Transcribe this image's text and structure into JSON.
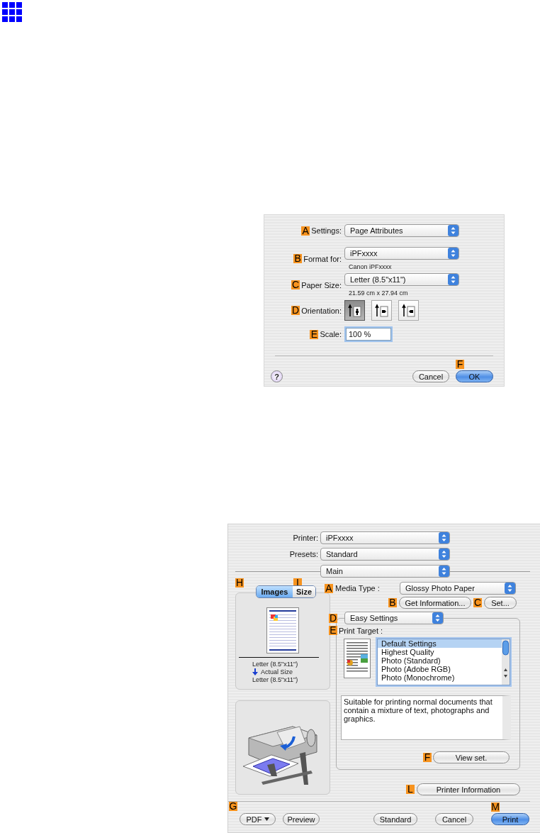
{
  "page_setup": {
    "rows": [
      {
        "kind": "popup",
        "marker": "A",
        "label": "Settings:",
        "value": "Page Attributes"
      },
      {
        "kind": "popup",
        "marker": "B",
        "label": "Format for:",
        "value": "iPFxxxx",
        "note": "Canon iPFxxxx"
      },
      {
        "kind": "popup",
        "marker": "C",
        "label": "Paper Size:",
        "value": "Letter (8.5\"x11\")",
        "note": "21.59 cm x 27.94 cm"
      },
      {
        "kind": "orientation",
        "marker": "D",
        "label": "Orientation:",
        "options": [
          {
            "selected": true
          },
          {
            "selected": false
          },
          {
            "selected": false
          }
        ]
      },
      {
        "kind": "field",
        "marker": "E",
        "label": "Scale:",
        "value": "100 %"
      }
    ],
    "help": "?",
    "buttons": [
      {
        "label": "Cancel",
        "default": false
      },
      {
        "marker": "F",
        "label": "OK",
        "default": true
      }
    ]
  },
  "print_dialog": {
    "top_rows": [
      {
        "label": "Printer:",
        "value": "iPFxxxx"
      },
      {
        "label": "Presets:",
        "value": "Standard"
      }
    ],
    "panel": "Main",
    "tabs": [
      {
        "marker": "H",
        "label": "Images",
        "selected": true
      },
      {
        "marker": "I",
        "label": "Size",
        "selected": false
      }
    ],
    "preview_text": {
      "source": "Letter (8.5\"x11\")",
      "scale": "Actual Size",
      "output": "Letter (8.5\"x11\")"
    },
    "media_type": {
      "marker": "A",
      "label": "Media Type :",
      "value": "Glossy Photo Paper"
    },
    "info_buttons": [
      {
        "marker": "B",
        "label": "Get Information..."
      },
      {
        "marker": "C",
        "label": "Set..."
      }
    ],
    "mode": {
      "marker": "D",
      "value": "Easy Settings"
    },
    "print_target": {
      "marker": "E",
      "label": "Print Target :",
      "items": [
        {
          "label": "Default Settings",
          "selected": true
        },
        {
          "label": "Highest Quality",
          "selected": false
        },
        {
          "label": "Photo (Standard)",
          "selected": false
        },
        {
          "label": "Photo (Adobe RGB)",
          "selected": false
        },
        {
          "label": "Photo (Monochrome)",
          "selected": false
        }
      ]
    },
    "description": "Suitable for printing normal documents that contain a mixture of text, photographs and graphics.",
    "view_settings": {
      "marker": "F",
      "label": "View set."
    },
    "printer_information": {
      "marker": "L",
      "label": "Printer Information"
    },
    "footer_left": {
      "marker": "G",
      "buttons": [
        {
          "label": "PDF",
          "menu": true
        },
        {
          "label": "Preview",
          "menu": false
        }
      ]
    },
    "footer_right": [
      {
        "label": "Standard",
        "default": false
      },
      {
        "label": "Cancel",
        "default": false
      },
      {
        "marker": "M",
        "label": "Print",
        "default": true
      }
    ]
  }
}
